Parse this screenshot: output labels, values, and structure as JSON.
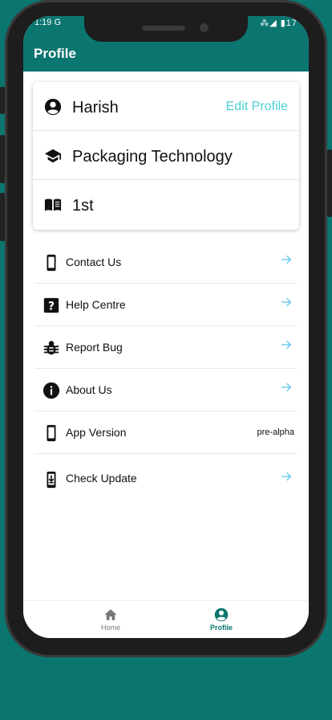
{
  "status_bar": {
    "time": "1:19",
    "extra": "G",
    "icons": "⁂◢ ▮17"
  },
  "app_bar": {
    "title": "Profile"
  },
  "profile_card": {
    "name": "Harish",
    "edit_label": "Edit Profile",
    "course": "Packaging Technology",
    "year": "1st"
  },
  "menu": {
    "items": [
      {
        "label": "Contact Us",
        "icon": "phone-icon"
      },
      {
        "label": "Help Centre",
        "icon": "help-icon"
      },
      {
        "label": "Report Bug",
        "icon": "bug-icon"
      },
      {
        "label": "About Us",
        "icon": "info-icon"
      },
      {
        "label": "App Version",
        "icon": "phone-icon",
        "value": "pre-alpha"
      },
      {
        "label": "Check Update",
        "icon": "download-phone-icon"
      }
    ]
  },
  "bottom_nav": {
    "home_label": "Home",
    "profile_label": "Profile"
  },
  "colors": {
    "primary": "#0b7670",
    "accent": "#4dd0d6",
    "arrow": "#5bc4ec"
  }
}
